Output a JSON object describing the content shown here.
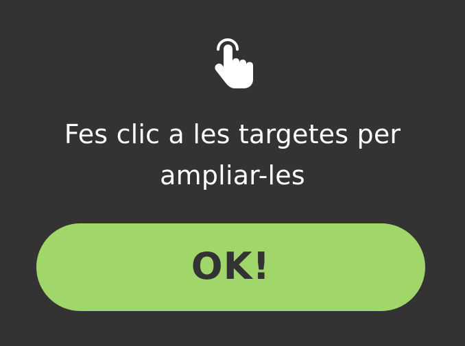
{
  "dialog": {
    "icon": "tap-finger-icon",
    "message_line1": "Fes clic a les targetes per",
    "message_line2": "ampliar-les",
    "ok_label": "OK!"
  },
  "colors": {
    "background": "#333333",
    "text": "#ffffff",
    "button": "#a1d66b",
    "button_text": "#333333"
  }
}
